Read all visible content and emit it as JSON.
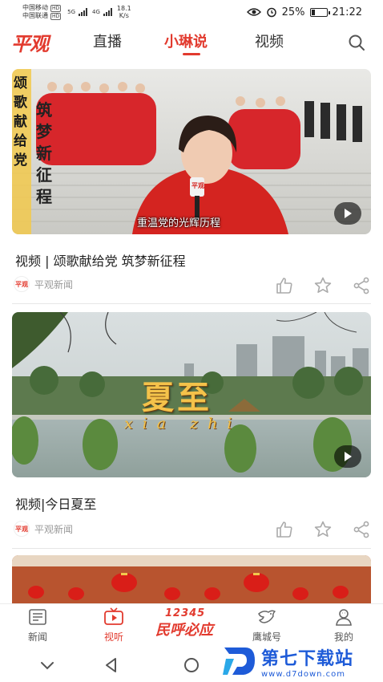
{
  "status_bar": {
    "carrier_1": "中国移动",
    "carrier_2": "中国联通",
    "hd": "HD",
    "net_1": "5G",
    "net_2": "4G",
    "speed_value": "18.1",
    "speed_unit": "K/s",
    "battery": "25%",
    "time": "21:22"
  },
  "header": {
    "logo": "平观",
    "tabs": [
      {
        "label": "直播",
        "active": false
      },
      {
        "label": "小琳说",
        "active": true
      },
      {
        "label": "视频",
        "active": false
      }
    ]
  },
  "feed": [
    {
      "thumb_left_caption": "颂歌献给党",
      "thumb_right_caption": "筑梦新征程",
      "thumb_subtitle": "重温党的光辉历程",
      "mic_label": "平观",
      "title": "视频 | 颂歌献给党 筑梦新征程",
      "source": "平观新闻"
    },
    {
      "thumb_title": "夏至",
      "thumb_pinyin": "xia zhi",
      "title": "视频|今日夏至",
      "source": "平观新闻"
    }
  ],
  "bottom_nav": {
    "items": [
      {
        "label": "新闻",
        "icon": "news-icon",
        "active": false
      },
      {
        "label": "视听",
        "icon": "tv-icon",
        "active": true
      },
      {
        "label": "鹰城号",
        "icon": "eagle-icon",
        "active": false
      },
      {
        "label": "我的",
        "icon": "user-icon",
        "active": false
      }
    ],
    "promo_number": "12345",
    "promo_text": "民呼必应"
  },
  "watermark": {
    "name": "第七下载站",
    "url": "www.d7down.com"
  },
  "colors": {
    "accent": "#e23a2e",
    "watermark_blue": "#1e5bd8"
  }
}
